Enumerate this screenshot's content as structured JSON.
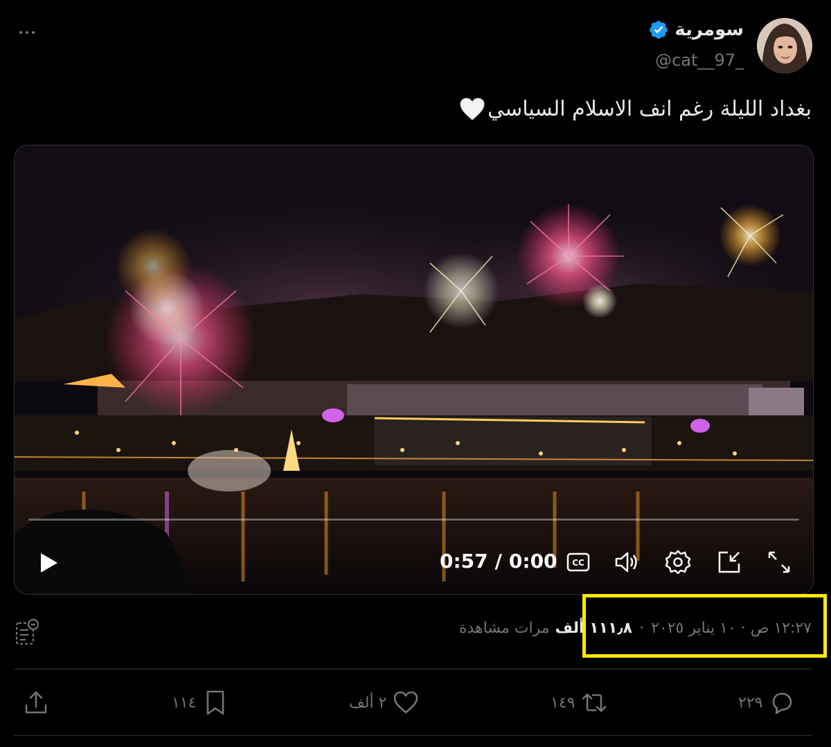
{
  "author": {
    "display_name": "سومرية",
    "handle": "@cat__97_",
    "verified": true
  },
  "tweet": {
    "text": "بغداد الليلة رغم انف الاسلام السياسي"
  },
  "video": {
    "elapsed": "0:57",
    "separator": "/",
    "total": "0:00",
    "progress": 0
  },
  "meta": {
    "timestamp": "١٢:٢٧ ص · ١٠ يناير ٢٠٢٥",
    "dot": "·",
    "views_count": "١١١٫٨ ألف",
    "views_label": "مرات مشاهدة"
  },
  "actions": {
    "replies": "٢٢٩",
    "reposts": "١٤٩",
    "likes": "٢ ألف",
    "bookmarks": "١١٤"
  },
  "colors": {
    "background": "#000000",
    "text": "#e7e9ea",
    "secondary": "#71767b",
    "verified": "#1d9bf0",
    "highlight": "#ffea00"
  },
  "icons": [
    "more-icon",
    "verified-badge-icon",
    "heart-emoji-icon",
    "play-icon",
    "captions-icon",
    "volume-icon",
    "settings-icon",
    "pip-icon",
    "fullscreen-icon",
    "analytics-icon",
    "reply-icon",
    "repost-icon",
    "like-icon",
    "bookmark-icon",
    "share-icon"
  ]
}
